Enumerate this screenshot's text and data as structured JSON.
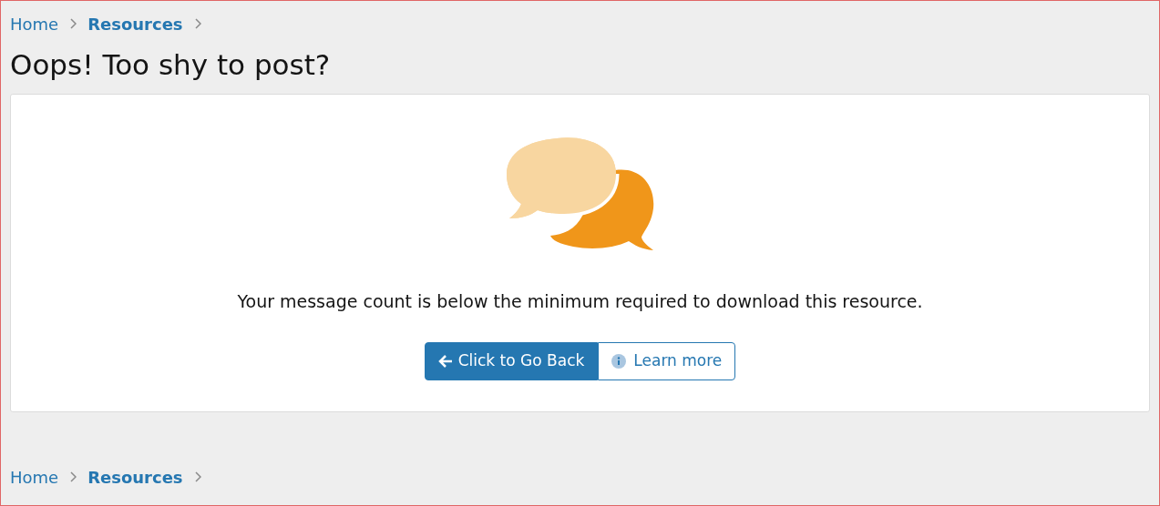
{
  "breadcrumbs_top": [
    {
      "label": "Home",
      "bold": false
    },
    {
      "label": "Resources",
      "bold": true
    }
  ],
  "title": "Oops! Too shy to post?",
  "message": "Your message count is below the minimum required to download this resource.",
  "buttons": [
    {
      "label": "Click to Go Back",
      "kind": "primary"
    },
    {
      "label": "Learn more",
      "kind": "secondary"
    }
  ],
  "breadcrumbs_bottom": [
    {
      "label": "Home",
      "bold": false
    },
    {
      "label": "Resources",
      "bold": true
    }
  ]
}
